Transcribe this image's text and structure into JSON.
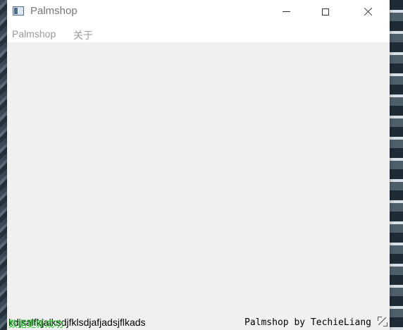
{
  "window": {
    "title": "Palmshop"
  },
  "menubar": {
    "items": [
      {
        "label": "Palmshop"
      },
      {
        "label": "关于"
      }
    ]
  },
  "statusbar": {
    "message": "kdjsalfkjalksdjfklsdjafjadsjflkads",
    "overlay_message": "数据更新成功",
    "permanent_label": "Palmshop by TechieLiang"
  },
  "colors": {
    "content_bg": "#f0f0f0",
    "status_ok": "#22c22a",
    "menu_text": "#9a9a9a"
  },
  "icons": {
    "app": "window-app-icon",
    "minimize": "minimize-icon",
    "maximize": "maximize-icon",
    "close": "close-icon",
    "resize": "size-grip-icon"
  }
}
